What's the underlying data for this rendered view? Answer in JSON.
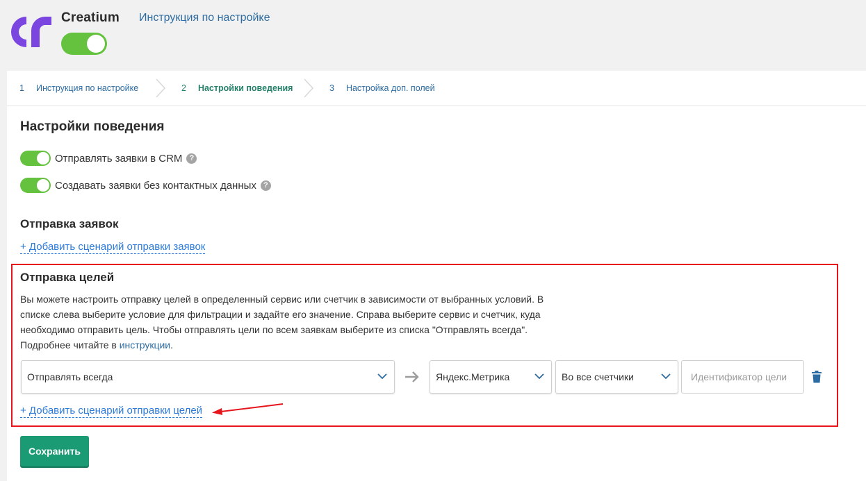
{
  "header": {
    "app_name": "Creatium",
    "setup_link": "Инструкция по настройке",
    "logo": "creatium-logo",
    "integration_enabled": true
  },
  "steps": [
    {
      "num": "1",
      "label": "Инструкция по настройке"
    },
    {
      "num": "2",
      "label": "Настройки поведения"
    },
    {
      "num": "3",
      "label": "Настройка доп. полей"
    }
  ],
  "behavior": {
    "title": "Настройки поведения",
    "toggles": [
      {
        "label": "Отправлять заявки в CRM",
        "on": true,
        "help_icon": "?"
      },
      {
        "label": "Создавать заявки без контактных данных",
        "on": true,
        "help_icon": "?"
      }
    ]
  },
  "leads": {
    "title": "Отправка заявок",
    "add_link": "+ Добавить сценарий отправки заявок"
  },
  "goals": {
    "title": "Отправка целей",
    "description": "Вы можете настроить отправку целей в определенный сервис или счетчик в зависимости от выбранных условий. В списке слева выберите условие для фильтрации и задайте его значение. Справа выберите сервис и счетчик, куда необходимо отправить цель. Чтобы отправлять цели по всем заявкам выберите из списка \"Отправлять всегда\". Подробнее читайте в ",
    "description_link": "инструкции",
    "description_end": ".",
    "condition_select": "Отправлять всегда",
    "service_select": "Яндекс.Метрика",
    "counter_select": "Во все счетчики",
    "goal_id_placeholder": "Идентификатор цели",
    "add_link": "+ Добавить сценарий отправки целей"
  },
  "colors": {
    "accent_green": "#64c23e",
    "button_green": "#1a9b74",
    "link_blue": "#2d7bd8",
    "highlight_red": "#e8141b",
    "logo_purple": "#7b45e0"
  },
  "save_button": "Сохранить"
}
